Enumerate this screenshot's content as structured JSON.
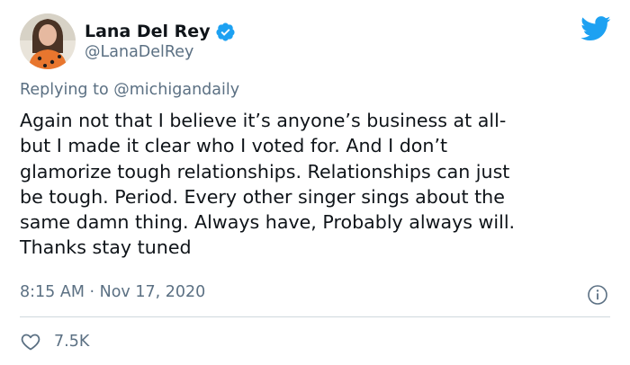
{
  "author": {
    "display_name": "Lana Del Rey",
    "handle": "@LanaDelRey",
    "verified": true
  },
  "reply": {
    "prefix": "Replying to",
    "mention": "@michigandaily"
  },
  "tweet": {
    "lines": [
      "Again not that I believe it’s anyone’s business at all-",
      "but I made it clear who I voted for. And I don’t",
      "glamorize tough relationships. Relationships can just",
      "be tough. Period. Every other singer sings about the",
      "same damn thing. Always have, Probably always will.",
      "Thanks stay tuned"
    ],
    "timestamp": "8:15 AM · Nov 17, 2020",
    "likes": "7.5K"
  },
  "icons": {
    "brand": "twitter-bird-icon",
    "verified": "verified-badge-icon",
    "info": "info-icon",
    "like": "heart-icon"
  },
  "colors": {
    "brand_blue": "#1da1f2",
    "secondary_text": "#5b7083",
    "primary_text": "#0f1419",
    "divider": "#cfd9de"
  }
}
